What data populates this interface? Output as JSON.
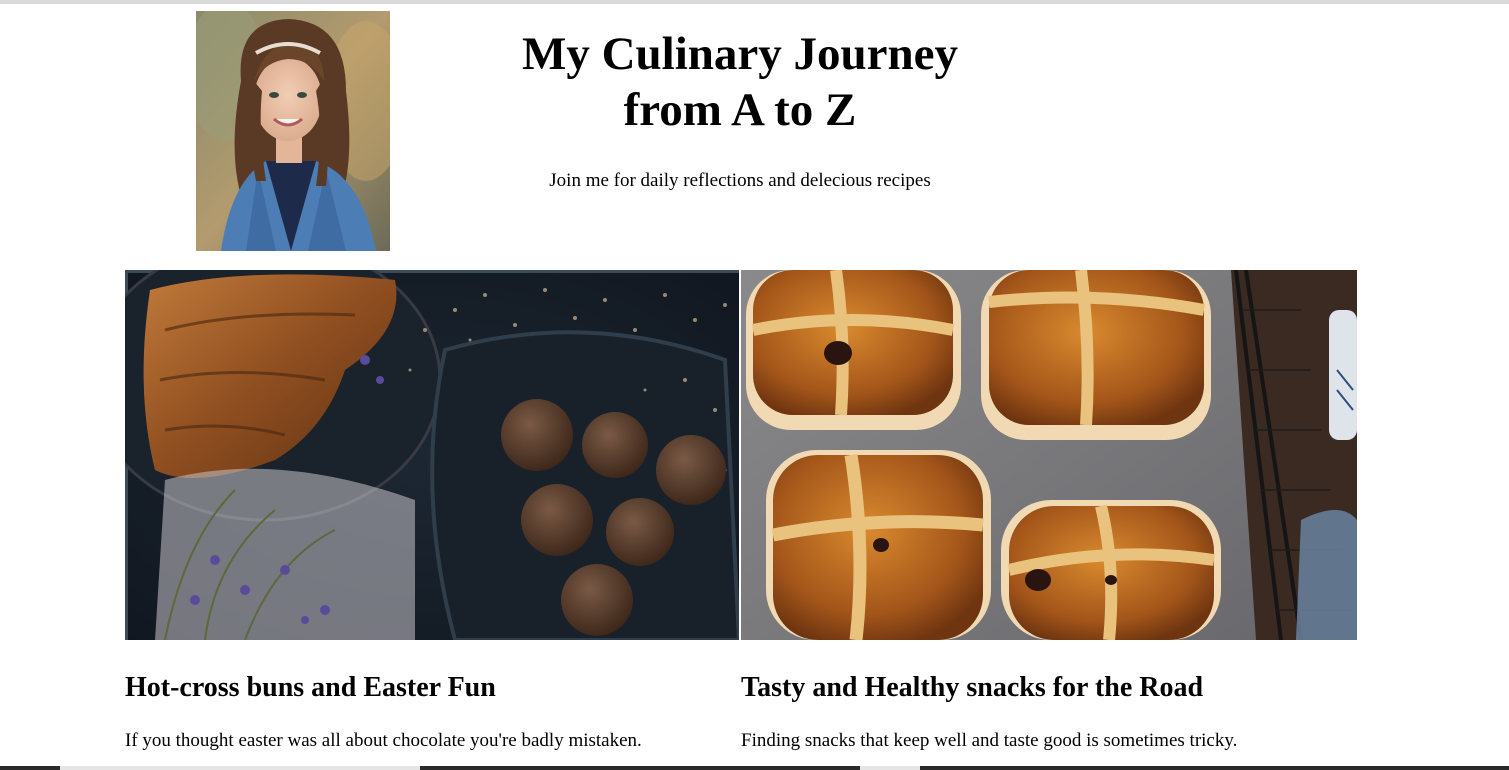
{
  "header": {
    "title_line1": "My Culinary Journey",
    "title_line2": "from A to Z",
    "tagline": "Join me for daily reflections and delecious recipes",
    "profile_photo": "portrait-of-smiling-girl-in-denim-jacket"
  },
  "posts": [
    {
      "image": "croissant-and-chocolate-truffles-on-dark-plates",
      "title": "Hot-cross buns and Easter Fun",
      "excerpt": "If you thought easter was all about chocolate you're badly mistaken."
    },
    {
      "image": "hot-cross-buns-on-baking-paper",
      "title": "Tasty and Healthy snacks for the Road",
      "excerpt": "Finding snacks that keep well and taste good is sometimes tricky."
    }
  ],
  "colors": {
    "background": "#ffffff",
    "text": "#000000"
  }
}
